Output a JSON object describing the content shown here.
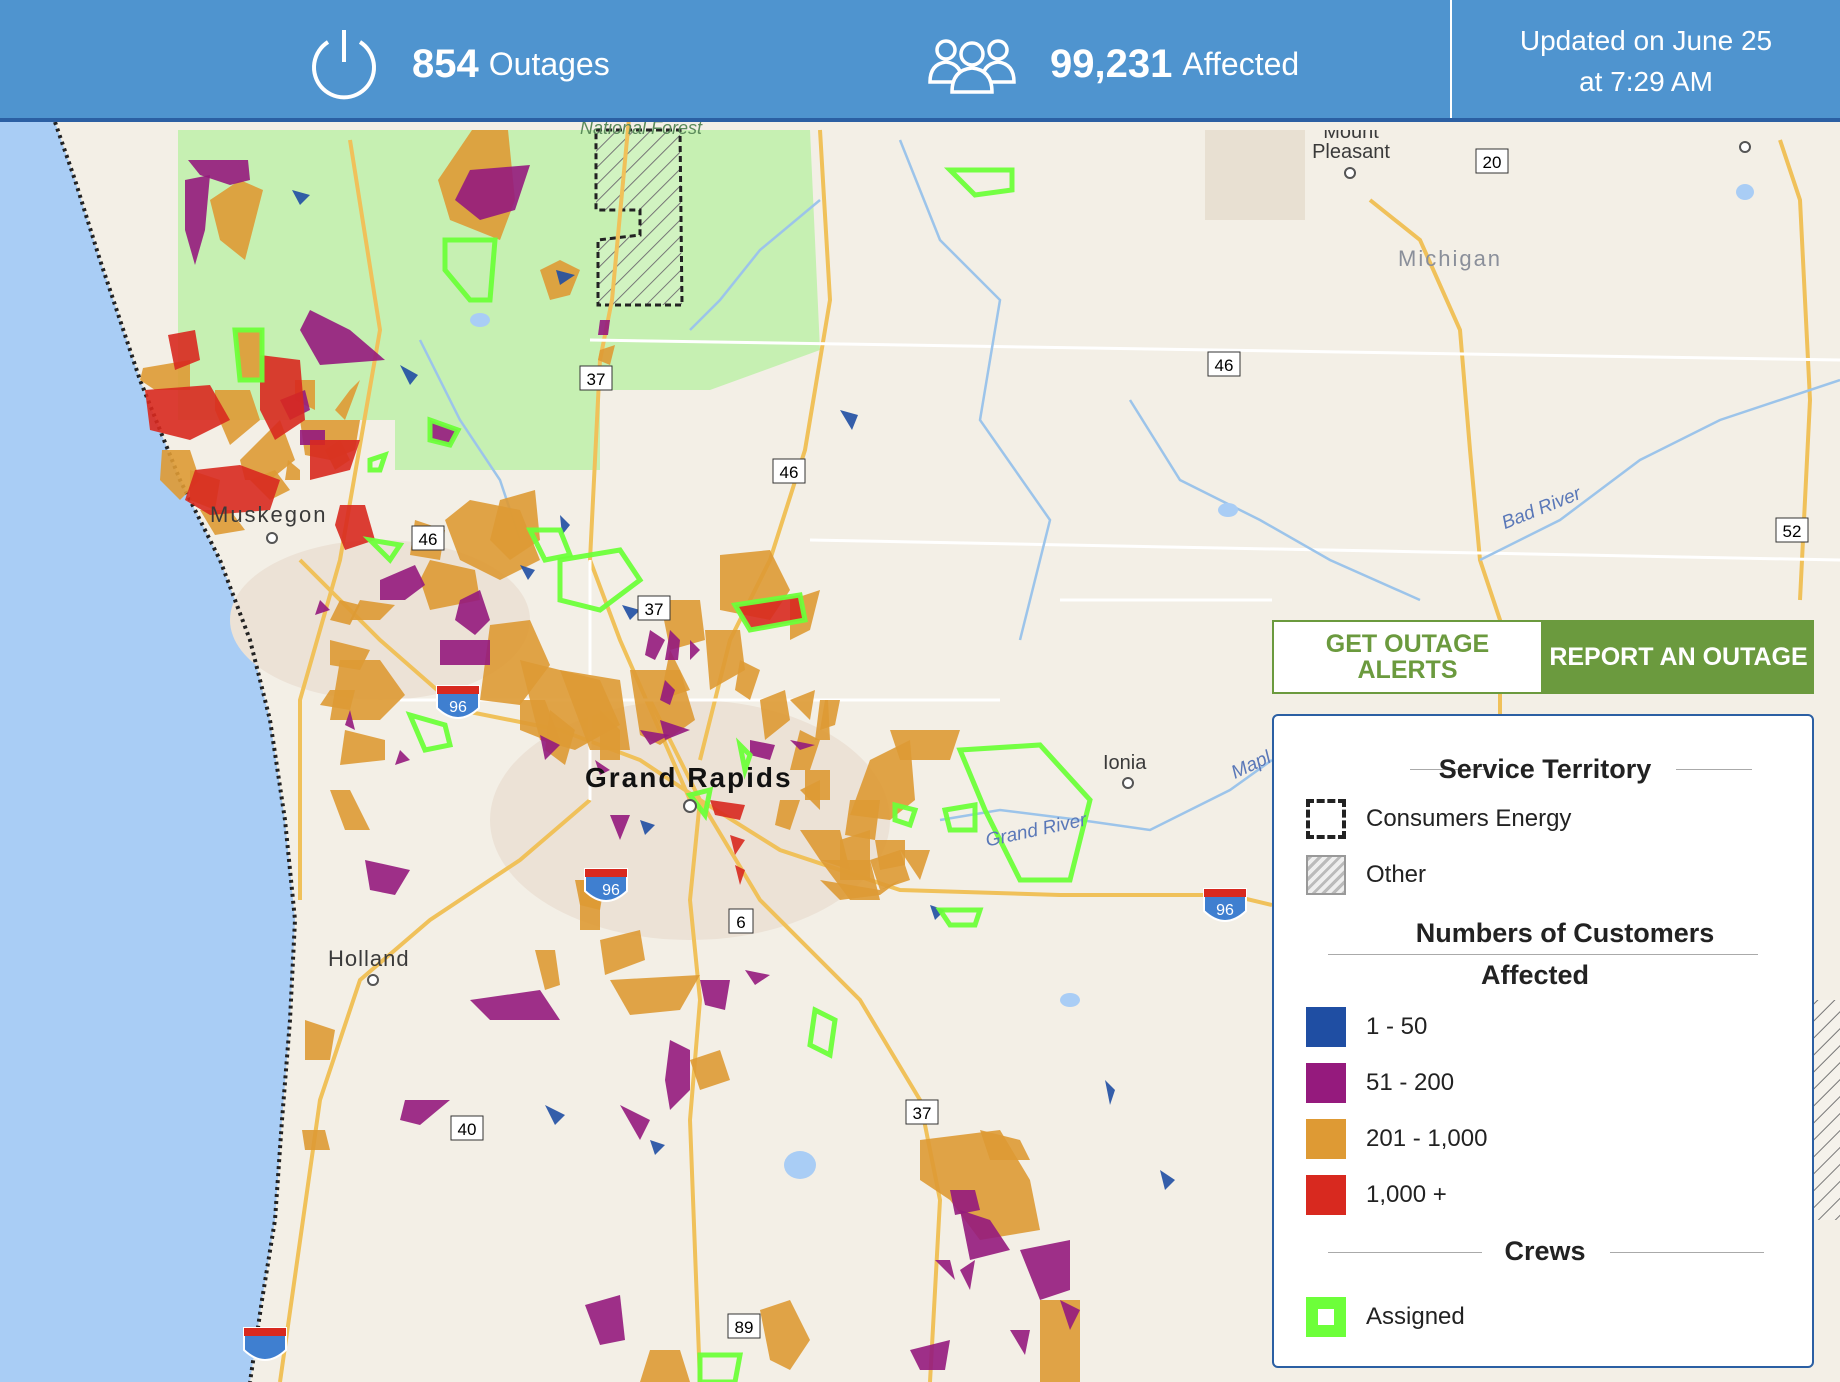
{
  "header": {
    "outages_count": "854",
    "outages_label": "Outages",
    "affected_count": "99,231",
    "affected_label": "Affected",
    "updated_line1": "Updated on June 25",
    "updated_line2": "at 7:29 AM"
  },
  "buttons": {
    "alerts": "GET OUTAGE ALERTS",
    "report": "REPORT AN OUTAGE"
  },
  "legend": {
    "territory_title": "Service Territory",
    "territory_items": [
      {
        "label": "Consumers Energy"
      },
      {
        "label": "Other"
      }
    ],
    "customers_title_1": "Numbers of Customers",
    "customers_title_2": "Affected",
    "customer_items": [
      {
        "label": "1 - 50",
        "color": "#1f4ea3"
      },
      {
        "label": "51 - 200",
        "color": "#951a7d"
      },
      {
        "label": "201 - 1,000",
        "color": "#de9a34"
      },
      {
        "label": "1,000 +",
        "color": "#d8291f"
      }
    ],
    "crews_title": "Crews",
    "crews_items": [
      {
        "label": "Assigned",
        "color": "#6dff3a"
      }
    ]
  },
  "map_labels": {
    "grand_rapids": "Grand Rapids",
    "muskegon": "Muskegon",
    "holland": "Holland",
    "ionia": "Ionia",
    "michigan": "Michigan",
    "mount_pleasant": "Mount Pleasant",
    "grand_river": "Grand River",
    "bad_river": "Bad River",
    "maple_river": "Maple River",
    "national_forest": "National Forest"
  },
  "routes": [
    "20",
    "37",
    "46",
    "46",
    "46",
    "37",
    "52",
    "96",
    "96",
    "96",
    "6",
    "40",
    "37",
    "89"
  ],
  "colors": {
    "header_bg": "#4f94cf",
    "water": "#a9cdf5",
    "land": "#f3efe6",
    "forest": "#c6f0b2",
    "road": "#f0c15a",
    "crew_outline": "#6dff3a"
  }
}
